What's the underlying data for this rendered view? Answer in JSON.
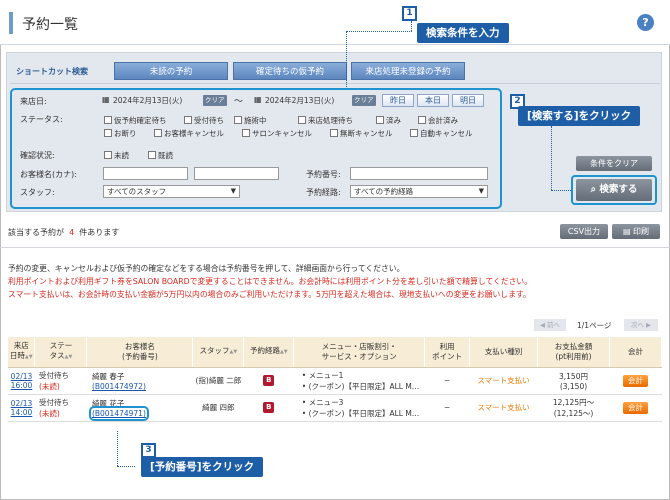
{
  "page": {
    "title": "予約一覧",
    "help": "?"
  },
  "shortcut": {
    "label": "ショートカット検索",
    "buttons": [
      "未読の予約",
      "確定待ちの仮予約",
      "来店処理未登録の予約"
    ]
  },
  "search": {
    "visit_date_label": "来店日:",
    "date_from": "2024年2月13日(火)",
    "date_to": "2024年2月13日(火)",
    "clear": "クリア",
    "tilde": "〜",
    "date_buttons": [
      "昨日",
      "本日",
      "明日"
    ],
    "status_label": "ステータス:",
    "status_items": [
      "仮予約確定待ち",
      "受付待ち",
      "施術中",
      "来店処理待ち",
      "済み",
      "会計済み",
      "お断り",
      "お客様キャンセル",
      "サロンキャンセル",
      "無断キャンセル",
      "自動キャンセル"
    ],
    "confirm_label": "確認状況:",
    "confirm_items": [
      "未読",
      "既読"
    ],
    "customer_label": "お客様名(カナ):",
    "reservation_no_label": "予約番号:",
    "staff_label": "スタッフ:",
    "staff_value": "すべてのスタッフ",
    "route_label": "予約経路:",
    "route_value": "すべての予約経路",
    "clear_conditions": "条件をクリア",
    "search_button": "検索する",
    "search_icon": "magnifier"
  },
  "callouts": [
    {
      "num": "1",
      "text": "検索条件を入力"
    },
    {
      "num": "2",
      "text": "[検索する]をクリック"
    },
    {
      "num": "3",
      "text": "[予約番号]をクリック"
    }
  ],
  "results": {
    "prefix": "該当する予約が",
    "count": "4",
    "suffix": "件あります",
    "csv": "CSV出力",
    "print": "印刷",
    "print_icon": "printer"
  },
  "notes": [
    "予約の変更、キャンセルおよび仮予約の確定などをする場合は予約番号を押して、詳細画面から行ってください。",
    "利用ポイントおよび利用ギフト券をSALON BOARDで変更することはできません。お会計時には利用ポイント分を差し引いた額で精算してください。",
    "スマート支払いは、お会計時の支払い金額が5万円以内の場合のみご利用いただけます。5万円を超えた場合は、現地支払いへの変更をお願いします。"
  ],
  "pager": {
    "prev": "◀ 前へ",
    "page": "1/1ページ",
    "next": "次へ ▶"
  },
  "table": {
    "headers": [
      "来店\n日時",
      "ステー\nタス",
      "お客様名\n(予約番号)",
      "スタッフ",
      "予約経路",
      "メニュー・店販割引・\nサービス・オプション",
      "利用\nポイント",
      "支払い種別",
      "お支払金額\n(pt利用前)",
      "会計"
    ],
    "rows": [
      {
        "date": "02/13",
        "time": "16:00",
        "status": "受付待ち",
        "sub": "(未読)",
        "name": "綺麗 春子",
        "no": "(B001474972)",
        "staff": "(指)綺麗 二郎",
        "route": "B",
        "menu1": "メニュー1",
        "menu2": "(クーポン)【平日限定】ALL M…",
        "point": "−",
        "pay": "スマート支払い",
        "amount": "3,150円",
        "amount2": "(3,150)",
        "btn": "会計"
      },
      {
        "date": "02/13",
        "time": "14:00",
        "status": "受付待ち",
        "sub": "(未読)",
        "name": "綺麗 花子",
        "no": "(B001474971)",
        "staff": "綺麗 四郎",
        "route": "B",
        "menu1": "メニュー3",
        "menu2": "(クーポン)【平日限定】ALL M…",
        "point": "−",
        "pay": "スマート支払い",
        "amount": "12,125円〜",
        "amount2": "(12,125〜)",
        "btn": "会計"
      }
    ]
  }
}
